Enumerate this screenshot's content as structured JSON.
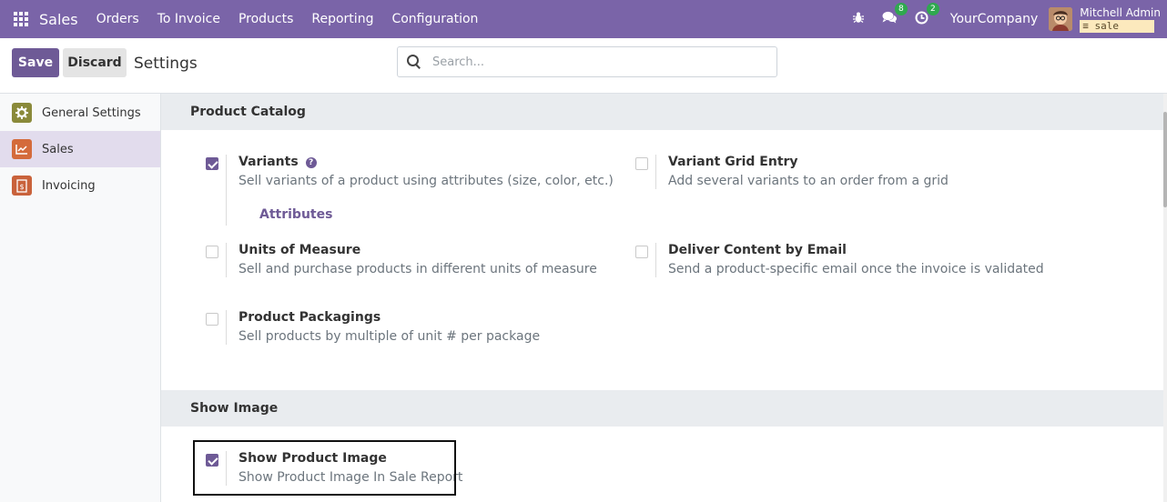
{
  "navbar": {
    "app_name": "Sales",
    "menus": [
      "Orders",
      "To Invoice",
      "Products",
      "Reporting",
      "Configuration"
    ],
    "messages_count": "8",
    "activities_count": "2",
    "company": "YourCompany",
    "user_name": "Mitchell Admin",
    "database": "sale"
  },
  "control_panel": {
    "save_label": "Save",
    "discard_label": "Discard",
    "title": "Settings",
    "search_placeholder": "Search..."
  },
  "sidebar": {
    "items": [
      {
        "label": "General Settings",
        "icon": "gear-icon",
        "color": "#8a8a3a",
        "active": false
      },
      {
        "label": "Sales",
        "icon": "chart-icon",
        "color": "#d46b3b",
        "active": true
      },
      {
        "label": "Invoicing",
        "icon": "invoice-icon",
        "color": "#c9623b",
        "active": false
      }
    ]
  },
  "sections": {
    "product_catalog": {
      "title": "Product Catalog",
      "variants": {
        "name": "Variants",
        "desc": "Sell variants of a product using attributes (size, color, etc.)",
        "checked": true,
        "link": "Attributes"
      },
      "variant_grid": {
        "name": "Variant Grid Entry",
        "desc": "Add several variants to an order from a grid",
        "checked": false
      },
      "uom": {
        "name": "Units of Measure",
        "desc": "Sell and purchase products in different units of measure",
        "checked": false
      },
      "deliver_email": {
        "name": "Deliver Content by Email",
        "desc": "Send a product-specific email once the invoice is validated",
        "checked": false
      },
      "packagings": {
        "name": "Product Packagings",
        "desc": "Sell products by multiple of unit # per package",
        "checked": false
      }
    },
    "show_image": {
      "title": "Show Image",
      "product_image": {
        "name": "Show Product Image",
        "desc": "Show Product Image In Sale Report",
        "checked": true
      }
    }
  },
  "colors": {
    "navbar": "#7a64a8",
    "primary": "#6e5a96",
    "active_sidebar": "#e2dced"
  }
}
